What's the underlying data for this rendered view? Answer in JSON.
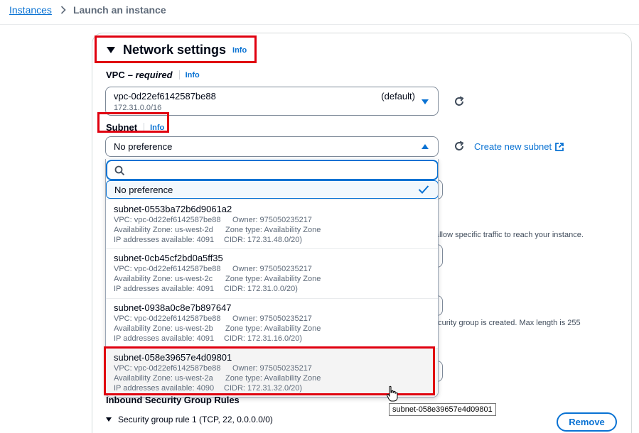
{
  "breadcrumb": {
    "parent": "Instances",
    "current": "Launch an instance"
  },
  "section": {
    "title": "Network settings",
    "info": "Info"
  },
  "vpc": {
    "label": "VPC",
    "qualifier": "– required",
    "info": "Info",
    "selected_id": "vpc-0d22ef6142587be88",
    "selected_cidr": "172.31.0.0/16",
    "selected_tag": "(default)"
  },
  "subnet": {
    "label": "Subnet",
    "info": "Info",
    "selected_value": "No preference",
    "create_link": "Create new subnet",
    "search_placeholder": "",
    "options": [
      {
        "id": "subnet-0553ba72b6d9061a2",
        "vpc": "VPC: vpc-0d22ef6142587be88",
        "owner": "Owner: 975050235217",
        "az": "Availability Zone: us-west-2d",
        "zone_type": "Zone type: Availability Zone",
        "ips": "IP addresses available: 4091",
        "cidr": "CIDR: 172.31.48.0/20)"
      },
      {
        "id": "subnet-0cb45cf2bd0a5ff35",
        "vpc": "VPC: vpc-0d22ef6142587be88",
        "owner": "Owner: 975050235217",
        "az": "Availability Zone: us-west-2c",
        "zone_type": "Zone type: Availability Zone",
        "ips": "IP addresses available: 4091",
        "cidr": "CIDR: 172.31.0.0/20)"
      },
      {
        "id": "subnet-0938a0c8e7b897647",
        "vpc": "VPC: vpc-0d22ef6142587be88",
        "owner": "Owner: 975050235217",
        "az": "Availability Zone: us-west-2b",
        "zone_type": "Zone type: Availability Zone",
        "ips": "IP addresses available: 4091",
        "cidr": "CIDR: 172.31.16.0/20)"
      },
      {
        "id": "subnet-058e39657e4d09801",
        "vpc": "VPC: vpc-0d22ef6142587be88",
        "owner": "Owner: 975050235217",
        "az": "Availability Zone: us-west-2a",
        "zone_type": "Zone type: Availability Zone",
        "ips": "IP addresses available: 4090",
        "cidr": "CIDR: 172.31.32.0/20)"
      }
    ]
  },
  "background": {
    "sg_text": "allow specific traffic to reach your instance.",
    "sg_desc": "ecurity group is created. Max length is 255"
  },
  "inbound": {
    "title": "Inbound Security Group Rules",
    "rule": "Security group rule 1 (TCP, 22, 0.0.0.0/0)",
    "remove_label": "Remove"
  },
  "tooltip": "subnet-058e39657e4d09801",
  "colors": {
    "accent": "#0972d3",
    "highlight": "#e0000f"
  }
}
